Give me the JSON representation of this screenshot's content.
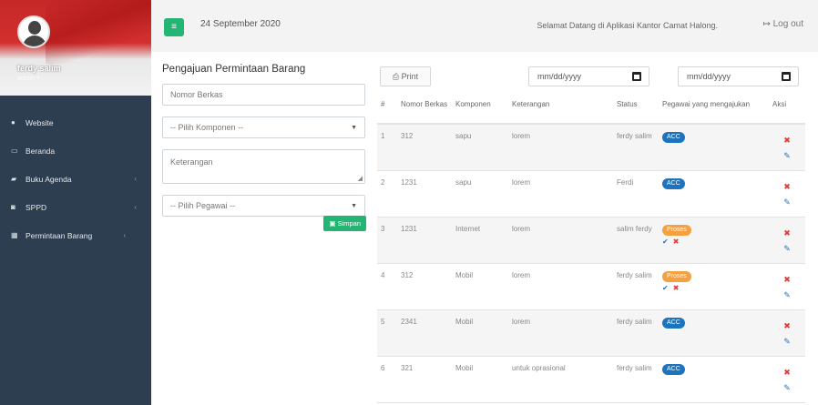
{
  "sidebar": {
    "user_name": "ferdy salim",
    "user_role": "admin",
    "items": [
      {
        "label": "Website",
        "icon": "globe-icon",
        "has_chevron": false
      },
      {
        "label": "Beranda",
        "icon": "monitor-icon",
        "has_chevron": false
      },
      {
        "label": "Buku Agenda",
        "icon": "book-icon",
        "has_chevron": true
      },
      {
        "label": "SPPD",
        "icon": "car-icon",
        "has_chevron": true
      },
      {
        "label": "Permintaan Barang",
        "icon": "grid-icon",
        "has_chevron": true
      }
    ]
  },
  "topbar": {
    "date": "24 September 2020",
    "welcome": "Selamat Datang di Aplikasi Kantor Camat Halong.",
    "logout_label": "Log out"
  },
  "form": {
    "title": "Pengajuan Permintaan Barang",
    "nomor_placeholder": "Nomor Berkas",
    "komponen_select": "-- Pilih Komponen --",
    "keterangan_placeholder": "Keterangan",
    "pegawai_select": "-- Pilih Pegawai --",
    "simpan_label": "Simpan"
  },
  "table_panel": {
    "print_label": "Print",
    "date_from_placeholder": "mm/dd/yyyy",
    "date_to_placeholder": "mm/dd/yyyy",
    "headers": [
      "#",
      "Nomor Berkas",
      "Komponen",
      "Keterangan",
      "Status",
      "Pegawai yang mengajukan",
      "Aksi"
    ],
    "rows": [
      {
        "no": "1",
        "nomor": "312",
        "komponen": "sapu",
        "keterangan": "lorem",
        "pegawai": "ferdy salim",
        "status": "ACC",
        "actions": false
      },
      {
        "no": "2",
        "nomor": "1231",
        "komponen": "sapu",
        "keterangan": "lorem",
        "pegawai": "Ferdi",
        "status": "ACC",
        "actions": false
      },
      {
        "no": "3",
        "nomor": "1231",
        "komponen": "Internet",
        "keterangan": "lorem",
        "pegawai": "salim ferdy",
        "status": "Proses",
        "actions": true
      },
      {
        "no": "4",
        "nomor": "312",
        "komponen": "Mobil",
        "keterangan": "lorem",
        "pegawai": "ferdy salim",
        "status": "Proses",
        "actions": true
      },
      {
        "no": "5",
        "nomor": "2341",
        "komponen": "Mobil",
        "keterangan": "lorem",
        "pegawai": "ferdy salim",
        "status": "ACC",
        "actions": false
      },
      {
        "no": "6",
        "nomor": "321",
        "komponen": "Mobil",
        "keterangan": "untuk oprasional",
        "pegawai": "ferdy salim",
        "status": "ACC",
        "actions": false
      }
    ]
  },
  "colors": {
    "sidebar_bg": "#2c3e50",
    "accent_green": "#22b573",
    "badge_acc": "#1e73be",
    "badge_proses": "#f5a142",
    "delete_red": "#e53935"
  }
}
